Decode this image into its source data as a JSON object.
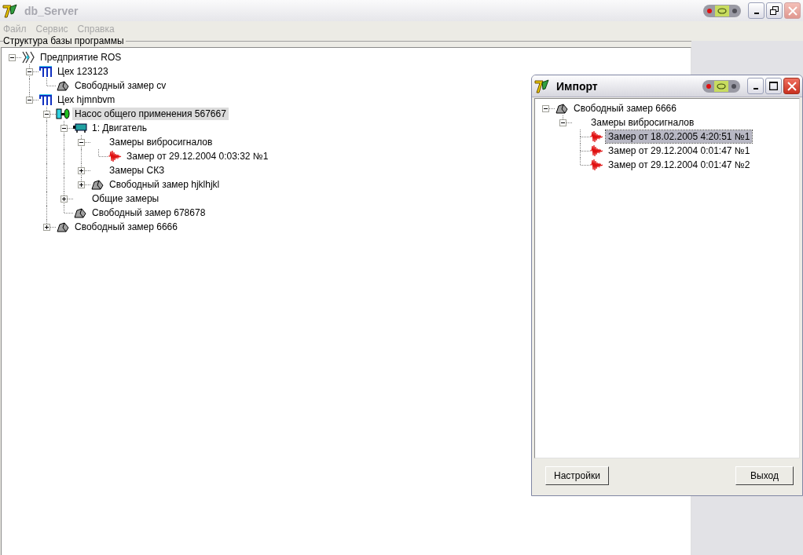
{
  "main_window": {
    "title": "db_Server",
    "active": false,
    "maximized": true,
    "menu": [
      "Файл",
      "Сервис",
      "Справка"
    ],
    "group_title": "Структура базы программы",
    "tree": [
      {
        "label": "Предприятие ROS",
        "kind": "enterprise",
        "expanded": true,
        "selected": false,
        "children": [
          {
            "label": "Цех 123123",
            "kind": "workshop",
            "expanded": true,
            "selected": false,
            "children": [
              {
                "label": "Свободный замер cv",
                "kind": "measurement",
                "selected": false
              }
            ]
          },
          {
            "label": "Цех hjmnbvm",
            "kind": "workshop",
            "expanded": true,
            "selected": false,
            "children": [
              {
                "label": "Насос общего применения 567667",
                "kind": "pump",
                "expanded": true,
                "selected": true,
                "children": [
                  {
                    "label": "1: Двигатель",
                    "kind": "motor",
                    "expanded": true,
                    "selected": false,
                    "children": [
                      {
                        "label": "Замеры вибросигналов",
                        "kind": "group",
                        "expanded": true,
                        "selected": false,
                        "children": [
                          {
                            "label": "Замер от 29.12.2004 0:03:32  №1",
                            "kind": "signal",
                            "selected": false
                          }
                        ]
                      },
                      {
                        "label": "Замеры СКЗ",
                        "kind": "group",
                        "expanded": false,
                        "selected": false
                      },
                      {
                        "label": "Свободный замер hjklhjkl",
                        "kind": "measurement",
                        "expanded": false,
                        "selected": false
                      }
                    ]
                  },
                  {
                    "label": "Общие замеры",
                    "kind": "group",
                    "expanded": false,
                    "selected": false
                  },
                  {
                    "label": "Свободный замер 678678",
                    "kind": "measurement",
                    "selected": false
                  }
                ]
              },
              {
                "label": "Свободный замер 6666",
                "kind": "measurement",
                "expanded": false,
                "selected": false
              }
            ]
          }
        ]
      }
    ]
  },
  "import_window": {
    "title": "Импорт",
    "active": true,
    "maximized": false,
    "tree": [
      {
        "label": "Свободный замер 6666",
        "kind": "measurement",
        "expanded": true,
        "selected": false,
        "children": [
          {
            "label": "Замеры вибросигналов",
            "kind": "group",
            "expanded": true,
            "selected": false,
            "children": [
              {
                "label": "Замер от 18.02.2005 4:20:51  №1",
                "kind": "signal",
                "selected": true
              },
              {
                "label": "Замер от 29.12.2004 0:01:47  №1",
                "kind": "signal",
                "selected": false
              },
              {
                "label": "Замер от 29.12.2004 0:01:47  №2",
                "kind": "signal",
                "selected": false
              }
            ]
          }
        ]
      }
    ],
    "buttons": [
      "Настройки",
      "Выход"
    ]
  }
}
